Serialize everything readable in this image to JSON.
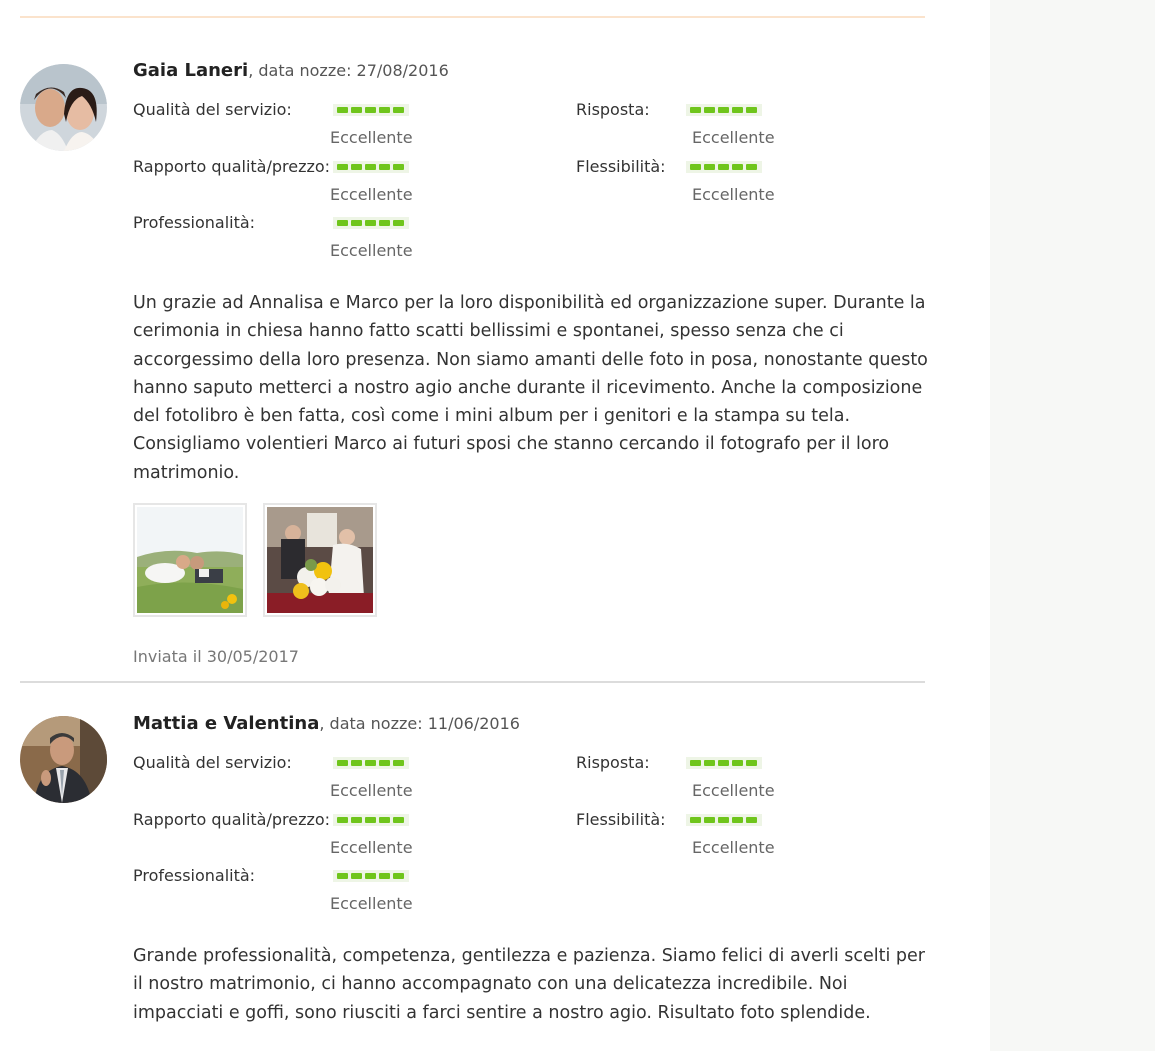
{
  "reviews": [
    {
      "author": "Gaia Laneri",
      "wedding_date_text": ", data nozze: 27/08/2016",
      "ratings": [
        {
          "label": "Qualità del servizio:",
          "value": "Eccellente",
          "score": 5
        },
        {
          "label": "Risposta:",
          "value": "Eccellente",
          "score": 5
        },
        {
          "label": "Rapporto qualità/prezzo:",
          "value": "Eccellente",
          "score": 5
        },
        {
          "label": "Flessibilità:",
          "value": "Eccellente",
          "score": 5
        },
        {
          "label": "Professionalità:",
          "value": "Eccellente",
          "score": 5
        }
      ],
      "text": "Un grazie ad Annalisa e Marco per la loro disponibilità ed organizzazione super. Durante la cerimonia in chiesa hanno fatto scatti bellissimi e spontanei, spesso senza che ci accorgessimo della loro presenza. Non siamo amanti delle foto in posa, nonostante questo hanno saputo metterci a nostro agio anche durante il ricevimento. Anche la composizione del fotolibro è ben fatta, così come i mini album per i genitori e la stampa su tela. Consigliamo volentieri Marco ai futuri sposi che stanno cercando il fotografo per il loro matrimonio.",
      "photos": [
        "couple-on-grass-photo",
        "bouquet-photo"
      ],
      "sent": "Inviata il 30/05/2017"
    },
    {
      "author": "Mattia e Valentina",
      "wedding_date_text": ", data nozze: 11/06/2016",
      "ratings": [
        {
          "label": "Qualità del servizio:",
          "value": "Eccellente",
          "score": 5
        },
        {
          "label": "Risposta:",
          "value": "Eccellente",
          "score": 5
        },
        {
          "label": "Rapporto qualità/prezzo:",
          "value": "Eccellente",
          "score": 5
        },
        {
          "label": "Flessibilità:",
          "value": "Eccellente",
          "score": 5
        },
        {
          "label": "Professionalità:",
          "value": "Eccellente",
          "score": 5
        }
      ],
      "text": "Grande professionalità, competenza, gentilezza e pazienza. Siamo felici di averli scelti per il nostro matrimonio, ci hanno accompagnato con una delicatezza incredibile. Noi impacciati e goffi, sono riusciti a farci sentire a nostro agio. Risultato foto splendide."
    }
  ],
  "colors": {
    "rating_green": "#6fc51b",
    "top_rule": "#fbe3cc",
    "separator": "#dcdcdc"
  }
}
